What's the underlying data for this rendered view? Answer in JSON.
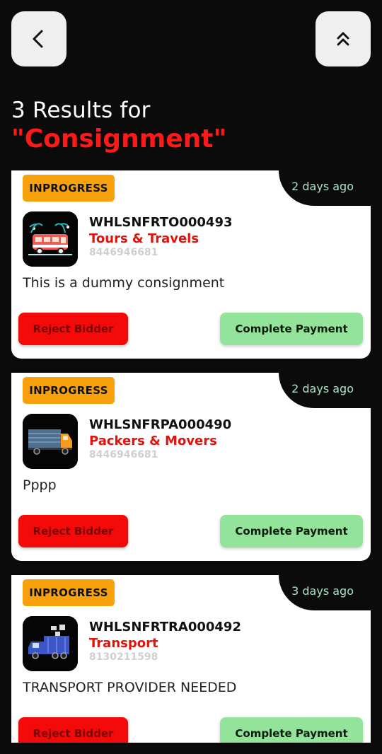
{
  "header": {
    "back_icon": "chevron-left-icon",
    "scroll_top_icon": "double-chevron-up-icon"
  },
  "results": {
    "count_text": "3 Results for",
    "query_text": "\"Consignment\""
  },
  "cards": [
    {
      "status": "INPROGRESS",
      "time_ago": "2 days ago",
      "id": "WHLSNFRTO000493",
      "category": "Tours & Travels",
      "phone": "8446946681",
      "description": "This is a dummy consignment",
      "thumb_icon": "tour-van-icon",
      "reject_label": "Reject Bidder",
      "pay_label": "Complete Payment"
    },
    {
      "status": "INPROGRESS",
      "time_ago": "2 days ago",
      "id": "WHLSNFRPA000490",
      "category": "Packers & Movers",
      "phone": "8446946681",
      "description": "Pppp",
      "thumb_icon": "moving-truck-icon",
      "reject_label": "Reject Bidder",
      "pay_label": "Complete Payment"
    },
    {
      "status": "INPROGRESS",
      "time_ago": "3 days ago",
      "id": "WHLSNFRTRA000492",
      "category": "Transport",
      "phone": "8130211598",
      "description": "TRANSPORT PROVIDER NEEDED",
      "thumb_icon": "transport-truck-icon",
      "reject_label": "Reject Bidder",
      "pay_label": "Complete Payment"
    }
  ],
  "colors": {
    "background": "#0b0b0b",
    "accent_red": "#e3120b",
    "status_orange": "#f7a20c",
    "pay_green": "#93e49a",
    "time_text": "#a9e4c8"
  }
}
